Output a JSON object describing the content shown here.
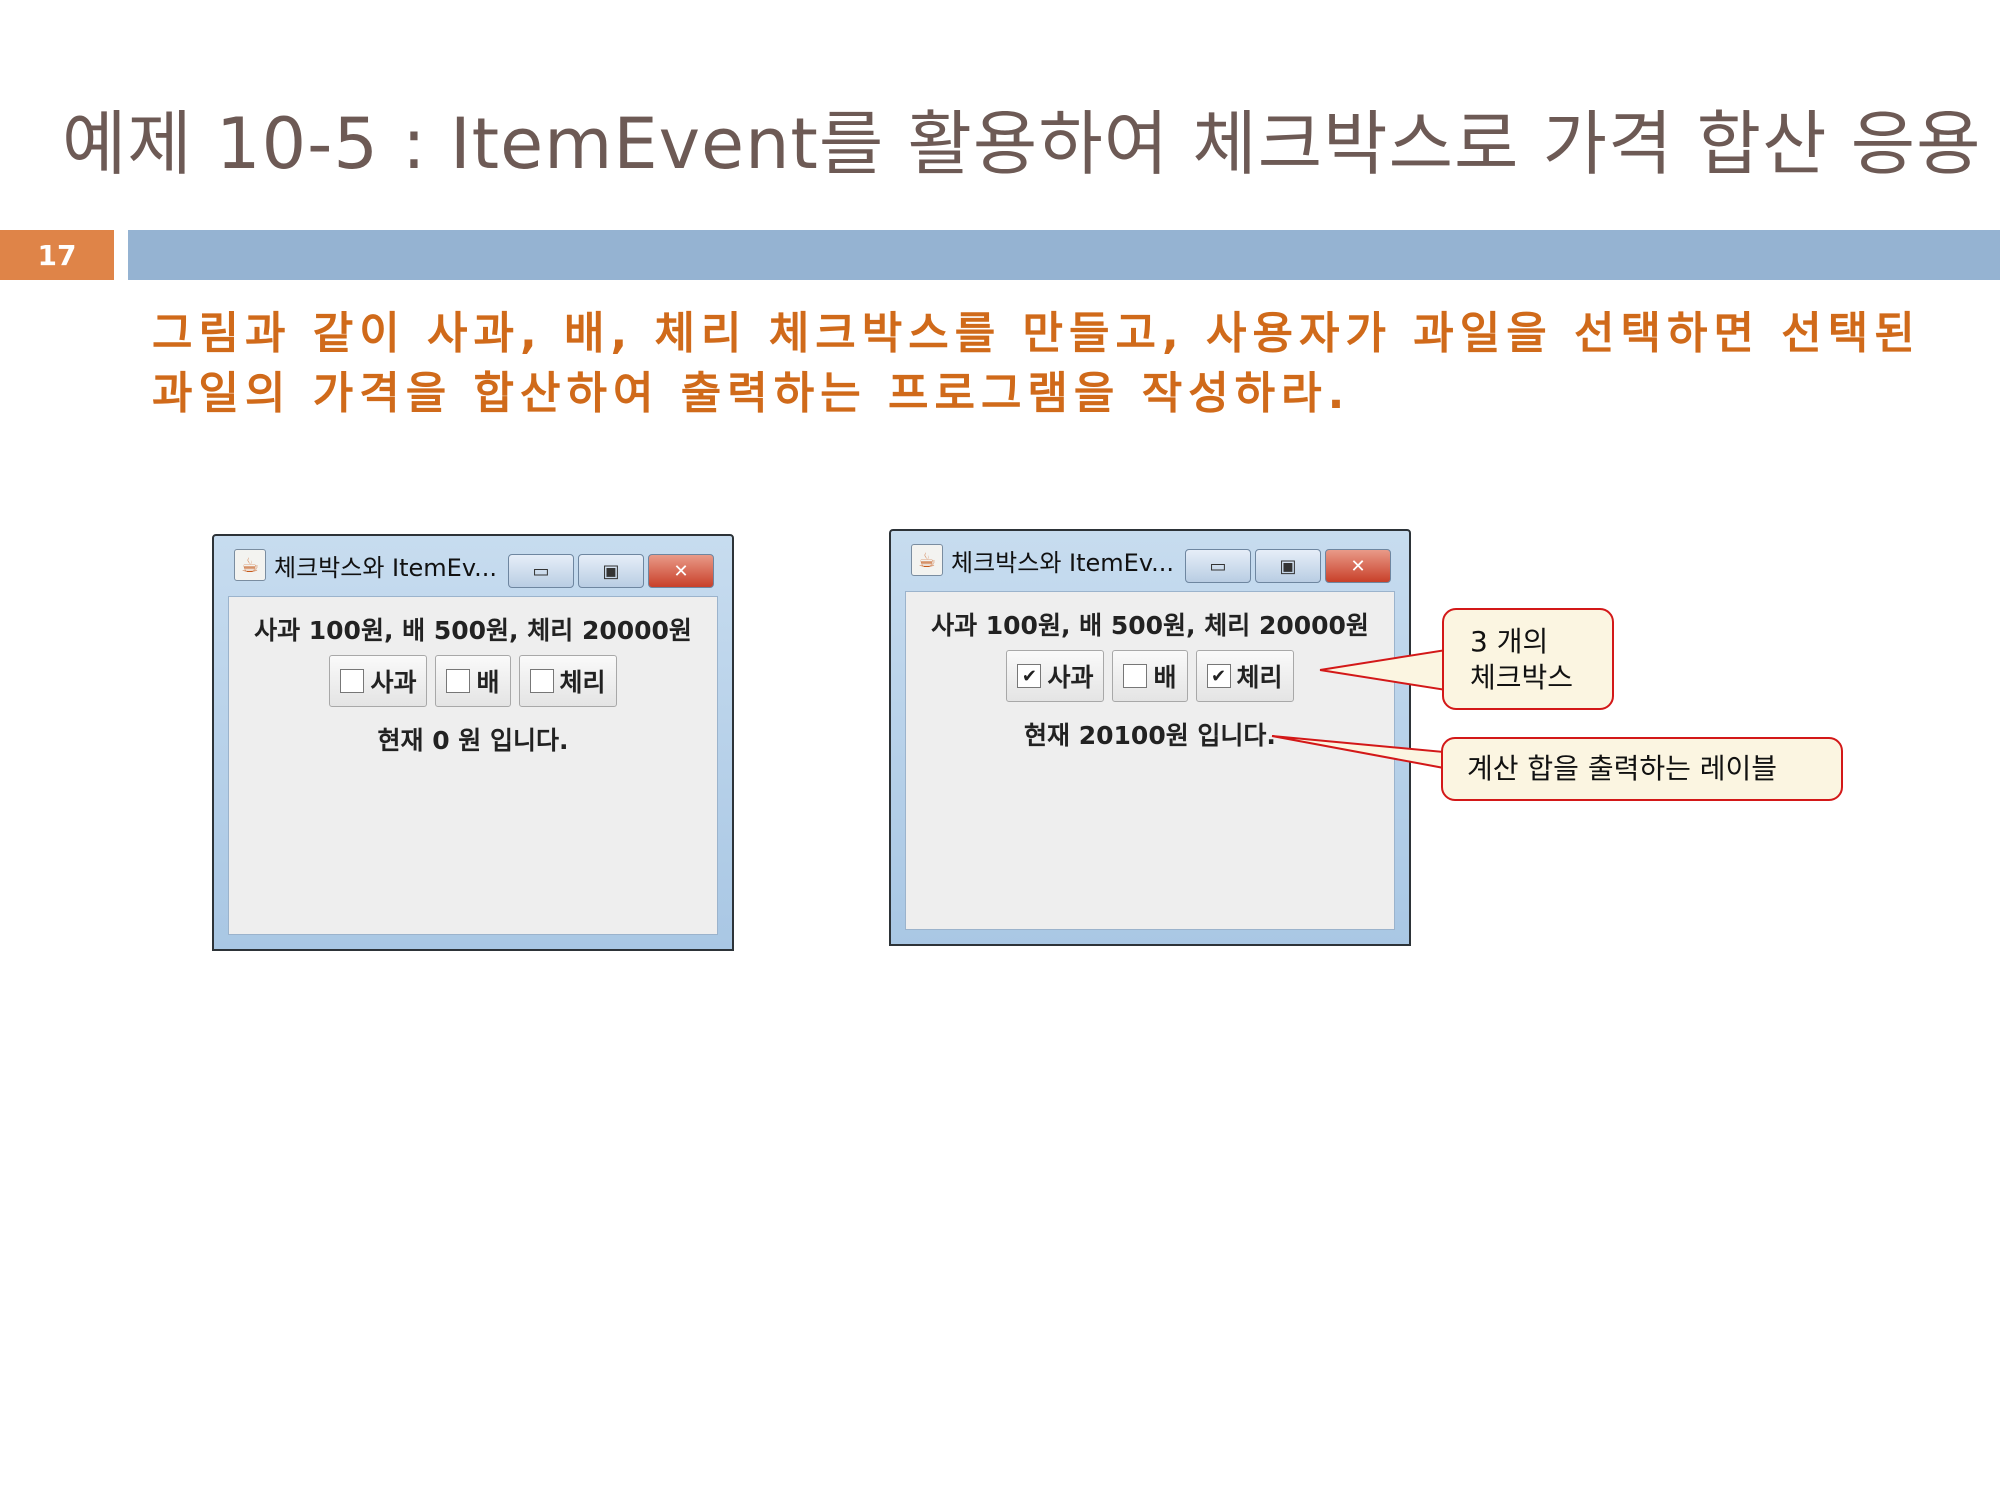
{
  "slide": {
    "title": "예제 10-5 : ItemEvent를 활용하여 체크박스로 가격 합산 응용",
    "page_number": "17",
    "description": "그림과 같이 사과, 배, 체리 체크박스를 만들고, 사용자가 과일을 선택하면 선택된 과일의 가격을 합산하여 출력하는 프로그램을 작성하라."
  },
  "window_left": {
    "caption": "체크박스와 ItemEv...",
    "price_text": "사과 100원, 배 500원, 체리 20000원",
    "checkboxes": [
      {
        "label": "사과",
        "checked": false
      },
      {
        "label": "배",
        "checked": false
      },
      {
        "label": "체리",
        "checked": false
      }
    ],
    "sum_text": "현재 0 원 입니다."
  },
  "window_right": {
    "caption": "체크박스와 ItemEv...",
    "price_text": "사과 100원, 배 500원, 체리 20000원",
    "checkboxes": [
      {
        "label": "사과",
        "checked": true
      },
      {
        "label": "배",
        "checked": false
      },
      {
        "label": "체리",
        "checked": true
      }
    ],
    "sum_text": "현재 20100원 입니다."
  },
  "callouts": {
    "checkboxes_line1": "3 개의",
    "checkboxes_line2": "체크박스",
    "label": "계산 합을 출력하는 레이블"
  },
  "icons": {
    "java": "java-cup-icon",
    "minimize": "minimize-icon",
    "maximize": "maximize-icon",
    "close": "close-icon",
    "check": "✔"
  },
  "colors": {
    "title": "#6d5a55",
    "badge": "#df8448",
    "title_bar": "#95b3d2",
    "description": "#d06a1a",
    "callout_border": "#d31818",
    "callout_fill": "#fbf5e1"
  }
}
